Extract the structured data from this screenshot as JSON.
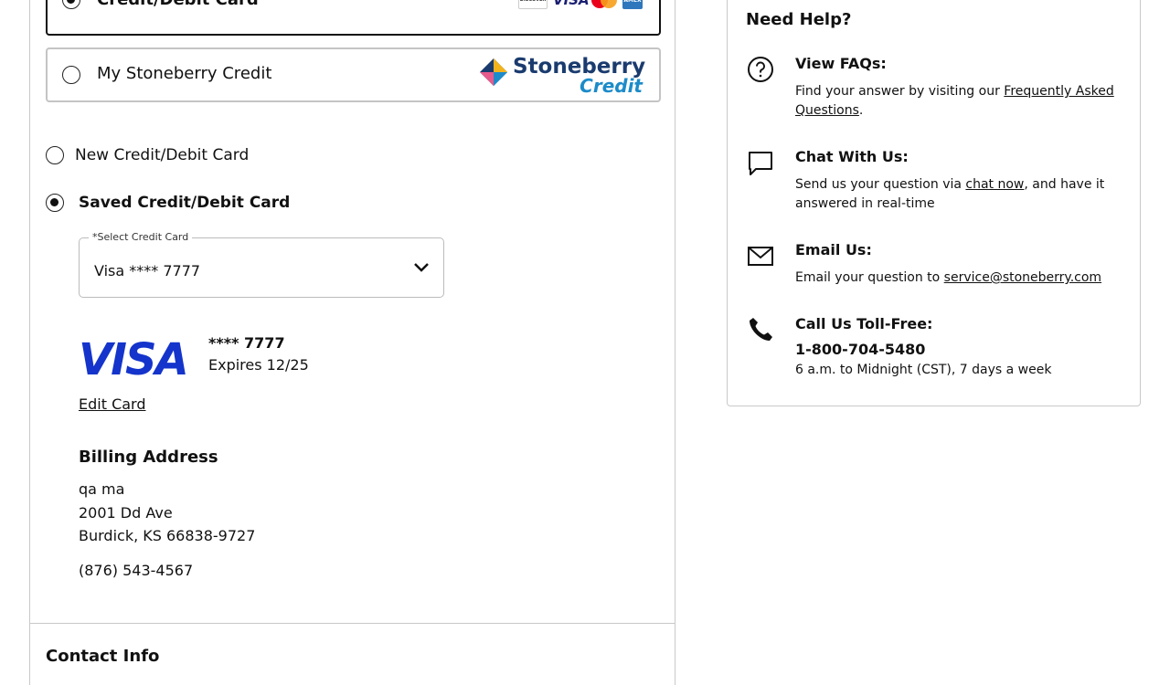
{
  "payment": {
    "credit_debit_label": "Credit/Debit Card",
    "stoneberry_credit_label": "My Stoneberry Credit",
    "card_logos": [
      "DISCOVER",
      "VISA",
      "mastercard",
      "AMEX"
    ],
    "stoneberry_logo": {
      "word": "Stoneberry",
      "sub": "Credit"
    }
  },
  "card_choice": {
    "new_label": "New Credit/Debit Card",
    "saved_label": "Saved Credit/Debit Card"
  },
  "select_card": {
    "label": "*Select Credit Card",
    "value": "Visa **** 7777"
  },
  "saved_card": {
    "brand": "VISA",
    "masked": "**** 7777",
    "expires": "Expires 12/25",
    "edit_label": "Edit Card"
  },
  "billing": {
    "title": "Billing Address",
    "name": "qa ma",
    "street": "2001 Dd Ave",
    "city_line": "Burdick, KS 66838-9727",
    "phone": "(876) 543-4567"
  },
  "contact": {
    "title": "Contact Info"
  },
  "help": {
    "title": "Need Help?",
    "faq": {
      "heading": "View FAQs:",
      "text_before": "Find your answer by visiting our ",
      "link": "Frequently Asked Questions",
      "text_after": "."
    },
    "chat": {
      "heading": "Chat With Us:",
      "text_before": "Send us your question via ",
      "link": "chat now",
      "text_after": ", and have it answered in real-time"
    },
    "email": {
      "heading": "Email Us:",
      "text_before": "Email your question to ",
      "link": "service@stoneberry.com"
    },
    "call": {
      "heading": "Call Us Toll-Free:",
      "number": "1-800-704-5480",
      "hours": "6 a.m. to Midnight (CST), 7 days a week"
    }
  }
}
